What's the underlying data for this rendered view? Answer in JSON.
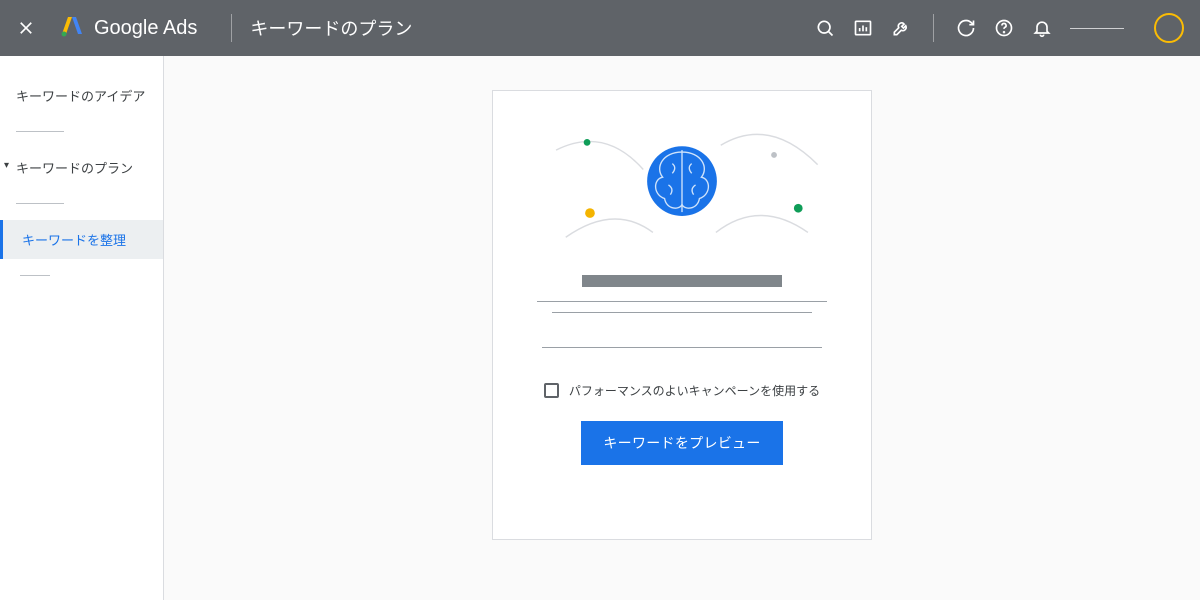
{
  "header": {
    "product": "Google Ads",
    "page_title": "キーワードのプラン"
  },
  "sidebar": {
    "item_ideas": "キーワードのアイデア",
    "item_plan": "キーワードのプラン",
    "item_organize": "キーワードを整理"
  },
  "card": {
    "checkbox_label": "パフォーマンスのよいキャンペーンを使用する",
    "button_label": "キーワードをプレビュー"
  }
}
